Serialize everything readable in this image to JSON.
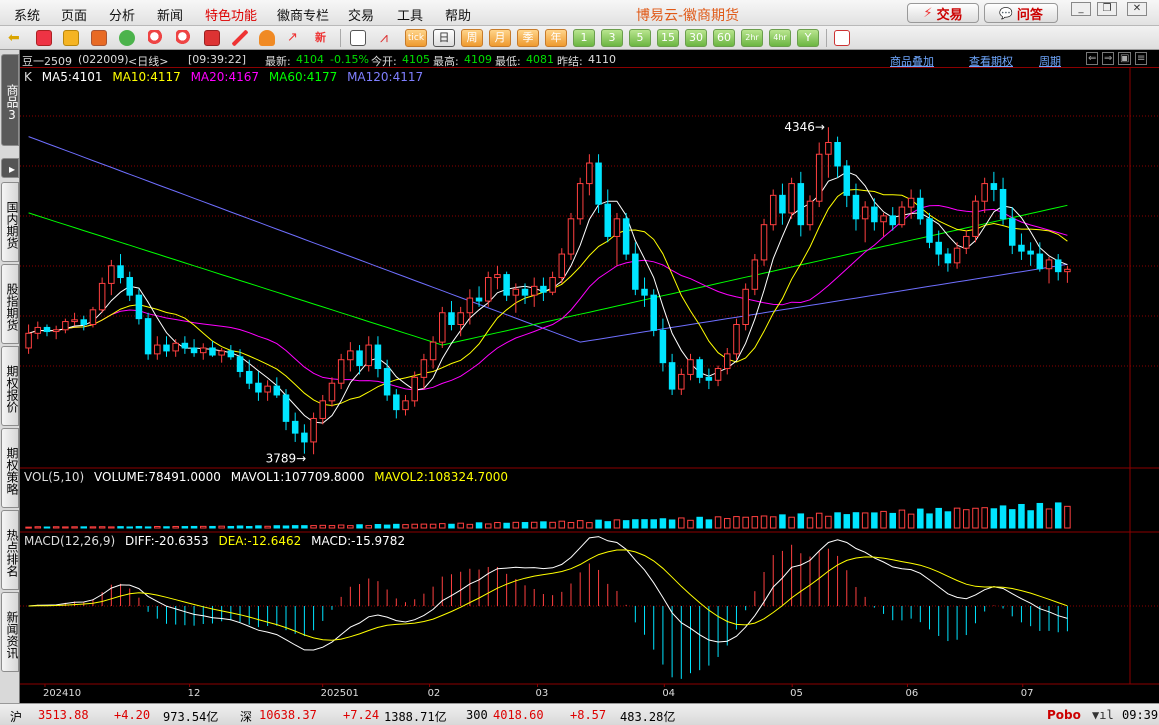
{
  "menu": {
    "items": [
      "系统",
      "页面",
      "分析",
      "新闻",
      "特色功能",
      "徽商专栏",
      "交易",
      "工具",
      "帮助"
    ],
    "app_title": "博易云-徽商期货",
    "trade_button": "交易",
    "qa_button": "问答"
  },
  "toolbar": {
    "period_buttons": [
      "日",
      "周",
      "月",
      "季",
      "年",
      "1",
      "3",
      "5",
      "15",
      "30",
      "60",
      "2hr",
      "4hr",
      "Y"
    ],
    "tick_label": "tick",
    "new_label": "新"
  },
  "sidebar": {
    "tabs": [
      "商品3",
      "国内期货",
      "股指期货",
      "期权报价",
      "期权策略",
      "热点排名",
      "新闻资讯"
    ]
  },
  "quote": {
    "instrument": "豆一2509",
    "code": "(022009)",
    "period": "<日线>",
    "time": "[09:39:22]",
    "last_label": "最新:",
    "last": "4104",
    "change": "-0.15%",
    "open_label": "今开:",
    "open": "4105",
    "high_label": "最高:",
    "high": "4109",
    "low_label": "最低:",
    "low": "4081",
    "prev_label": "昨结:",
    "prev": "4110"
  },
  "links": [
    "商品叠加",
    "查看期权",
    "周期"
  ],
  "ma_legend": {
    "k": "K",
    "ma5": "MA5:4101",
    "ma10": "MA10:4117",
    "ma20": "MA20:4167",
    "ma60": "MA60:4177",
    "ma120": "MA120:4117"
  },
  "volume_legend": {
    "name": "VOL(5,10)",
    "volume": "VOLUME:78491.0000",
    "mavol1": "MAVOL1:107709.8000",
    "mavol2": "MAVOL2:108324.7000"
  },
  "macd_legend": {
    "name": "MACD(12,26,9)",
    "diff": "DIFF:-20.6353",
    "dea": "DEA:-12.6462",
    "macd": "MACD:-15.9782"
  },
  "colors": {
    "up": "#ff4040",
    "down": "#00e5ff",
    "ma5": "#ffffff",
    "ma10": "#ffff00",
    "ma20": "#ff00ff",
    "ma60": "#00ff00",
    "ma120": "#6f6fff",
    "grid": "#8b0000"
  },
  "chart_data": {
    "type": "candlestick",
    "price_high_label": "4346",
    "price_low_label": "3789",
    "x_labels": [
      "202410",
      "12",
      "202501",
      "02",
      "03",
      "04",
      "05",
      "06",
      "07"
    ],
    "ohlc": [
      [
        3970,
        4010,
        3960,
        3995
      ],
      [
        3995,
        4015,
        3985,
        4005
      ],
      [
        4005,
        4010,
        3990,
        3998
      ],
      [
        3998,
        4008,
        3985,
        4001
      ],
      [
        4001,
        4020,
        3995,
        4015
      ],
      [
        4015,
        4030,
        4008,
        4018
      ],
      [
        4018,
        4025,
        4000,
        4010
      ],
      [
        4010,
        4040,
        4005,
        4035
      ],
      [
        4035,
        4090,
        4030,
        4080
      ],
      [
        4080,
        4120,
        4060,
        4110
      ],
      [
        4110,
        4130,
        4080,
        4090
      ],
      [
        4090,
        4100,
        4050,
        4060
      ],
      [
        4060,
        4070,
        4010,
        4020
      ],
      [
        4020,
        4030,
        3950,
        3960
      ],
      [
        3960,
        3990,
        3950,
        3975
      ],
      [
        3975,
        3990,
        3955,
        3965
      ],
      [
        3965,
        3985,
        3955,
        3978
      ],
      [
        3978,
        3990,
        3960,
        3970
      ],
      [
        3970,
        3985,
        3955,
        3962
      ],
      [
        3962,
        3978,
        3950,
        3970
      ],
      [
        3970,
        3982,
        3955,
        3958
      ],
      [
        3958,
        3970,
        3945,
        3965
      ],
      [
        3965,
        3975,
        3950,
        3955
      ],
      [
        3955,
        3968,
        3920,
        3930
      ],
      [
        3930,
        3950,
        3900,
        3910
      ],
      [
        3910,
        3930,
        3880,
        3895
      ],
      [
        3895,
        3915,
        3880,
        3905
      ],
      [
        3905,
        3920,
        3885,
        3890
      ],
      [
        3890,
        3900,
        3830,
        3845
      ],
      [
        3845,
        3860,
        3810,
        3825
      ],
      [
        3825,
        3840,
        3790,
        3810
      ],
      [
        3810,
        3860,
        3789,
        3850
      ],
      [
        3850,
        3890,
        3840,
        3880
      ],
      [
        3880,
        3920,
        3870,
        3910
      ],
      [
        3910,
        3960,
        3900,
        3950
      ],
      [
        3950,
        3980,
        3930,
        3965
      ],
      [
        3965,
        3975,
        3925,
        3940
      ],
      [
        3940,
        3990,
        3930,
        3975
      ],
      [
        3975,
        3990,
        3920,
        3935
      ],
      [
        3935,
        3950,
        3880,
        3890
      ],
      [
        3890,
        3900,
        3850,
        3865
      ],
      [
        3865,
        3890,
        3855,
        3880
      ],
      [
        3880,
        3930,
        3870,
        3920
      ],
      [
        3920,
        3960,
        3900,
        3950
      ],
      [
        3950,
        3990,
        3935,
        3980
      ],
      [
        3980,
        4040,
        3970,
        4030
      ],
      [
        4030,
        4050,
        4000,
        4010
      ],
      [
        4010,
        4040,
        3990,
        4030
      ],
      [
        4030,
        4070,
        4010,
        4055
      ],
      [
        4055,
        4075,
        4040,
        4050
      ],
      [
        4050,
        4100,
        4040,
        4090
      ],
      [
        4090,
        4110,
        4070,
        4095
      ],
      [
        4095,
        4100,
        4050,
        4060
      ],
      [
        4060,
        4080,
        4030,
        4070
      ],
      [
        4070,
        4080,
        4045,
        4060
      ],
      [
        4060,
        4090,
        4040,
        4075
      ],
      [
        4075,
        4090,
        4050,
        4065
      ],
      [
        4065,
        4100,
        4060,
        4090
      ],
      [
        4090,
        4140,
        4080,
        4130
      ],
      [
        4130,
        4200,
        4120,
        4190
      ],
      [
        4190,
        4260,
        4180,
        4250
      ],
      [
        4250,
        4300,
        4230,
        4285
      ],
      [
        4285,
        4300,
        4200,
        4215
      ],
      [
        4215,
        4240,
        4150,
        4160
      ],
      [
        4160,
        4200,
        4110,
        4190
      ],
      [
        4190,
        4200,
        4120,
        4130
      ],
      [
        4130,
        4150,
        4060,
        4070
      ],
      [
        4070,
        4090,
        4040,
        4060
      ],
      [
        4060,
        4070,
        3990,
        4000
      ],
      [
        4000,
        4020,
        3930,
        3945
      ],
      [
        3945,
        3960,
        3890,
        3900
      ],
      [
        3900,
        3935,
        3890,
        3925
      ],
      [
        3925,
        3960,
        3915,
        3950
      ],
      [
        3950,
        3955,
        3910,
        3920
      ],
      [
        3920,
        3935,
        3900,
        3915
      ],
      [
        3915,
        3940,
        3905,
        3935
      ],
      [
        3935,
        3970,
        3925,
        3960
      ],
      [
        3960,
        4020,
        3950,
        4010
      ],
      [
        4010,
        4080,
        4000,
        4070
      ],
      [
        4070,
        4130,
        4060,
        4120
      ],
      [
        4120,
        4190,
        4110,
        4180
      ],
      [
        4180,
        4240,
        4170,
        4230
      ],
      [
        4230,
        4250,
        4180,
        4200
      ],
      [
        4200,
        4260,
        4190,
        4250
      ],
      [
        4250,
        4270,
        4160,
        4180
      ],
      [
        4180,
        4230,
        4170,
        4220
      ],
      [
        4220,
        4320,
        4210,
        4300
      ],
      [
        4300,
        4346,
        4260,
        4320
      ],
      [
        4320,
        4330,
        4260,
        4280
      ],
      [
        4280,
        4290,
        4210,
        4230
      ],
      [
        4230,
        4250,
        4170,
        4190
      ],
      [
        4190,
        4220,
        4150,
        4210
      ],
      [
        4210,
        4225,
        4170,
        4185
      ],
      [
        4185,
        4200,
        4160,
        4195
      ],
      [
        4195,
        4210,
        4170,
        4180
      ],
      [
        4180,
        4220,
        4175,
        4210
      ],
      [
        4210,
        4240,
        4190,
        4225
      ],
      [
        4225,
        4240,
        4180,
        4190
      ],
      [
        4190,
        4200,
        4140,
        4150
      ],
      [
        4150,
        4170,
        4110,
        4130
      ],
      [
        4130,
        4140,
        4100,
        4115
      ],
      [
        4115,
        4150,
        4105,
        4140
      ],
      [
        4140,
        4170,
        4130,
        4160
      ],
      [
        4160,
        4230,
        4150,
        4220
      ],
      [
        4220,
        4260,
        4200,
        4250
      ],
      [
        4250,
        4270,
        4220,
        4240
      ],
      [
        4240,
        4260,
        4180,
        4190
      ],
      [
        4190,
        4210,
        4130,
        4145
      ],
      [
        4145,
        4165,
        4120,
        4135
      ],
      [
        4135,
        4150,
        4110,
        4130
      ],
      [
        4130,
        4150,
        4100,
        4105
      ],
      [
        4105,
        4125,
        4080,
        4120
      ],
      [
        4120,
        4130,
        4085,
        4100
      ],
      [
        4100,
        4110,
        4081,
        4104
      ]
    ],
    "volume_scale_max": 300000,
    "macd_range": [
      -120,
      90
    ]
  },
  "statusbar": {
    "sh_label": "沪",
    "sh_value": "3513.88",
    "sh_change": "+4.20",
    "sh_amount": "973.54亿",
    "sz_label": "深",
    "sz_value": "10638.37",
    "sz_change": "+7.24",
    "sz_amount": "1388.71亿",
    "c300_label": "300",
    "c300_value": "4018.60",
    "c300_change": "+8.57",
    "c300_amount": "483.28亿",
    "brand": "Pobo",
    "clock": "09:39"
  }
}
